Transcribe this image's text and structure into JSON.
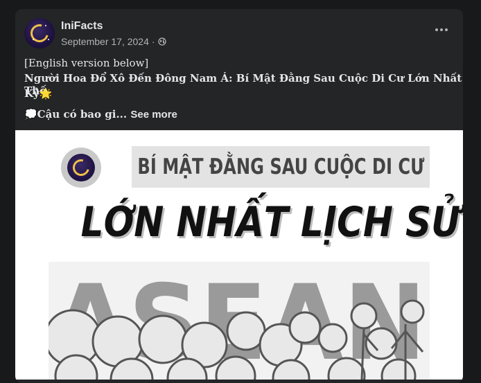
{
  "post": {
    "page_name": "IniFacts",
    "date": "September 17, 2024",
    "separator": "·",
    "line1": "[English version below]",
    "line2": "Người Hoa Đổ Xô Đến Đông Nam Á: Bí Mật Đằng Sau Cuộc Di Cư Lớn Nhất Thế",
    "line3": "Kỷ🌟",
    "line4": "💭Cậu có bao gi...",
    "see_more": "See more",
    "icons": [
      "globe-icon",
      "more-options-icon"
    ]
  },
  "image": {
    "banner": "BÍ MẬT ĐẰNG SAU CUỘC DI CƯ",
    "headline": "LỚN NHẤT LỊCH SỬ",
    "background_word": "ASEAN"
  }
}
